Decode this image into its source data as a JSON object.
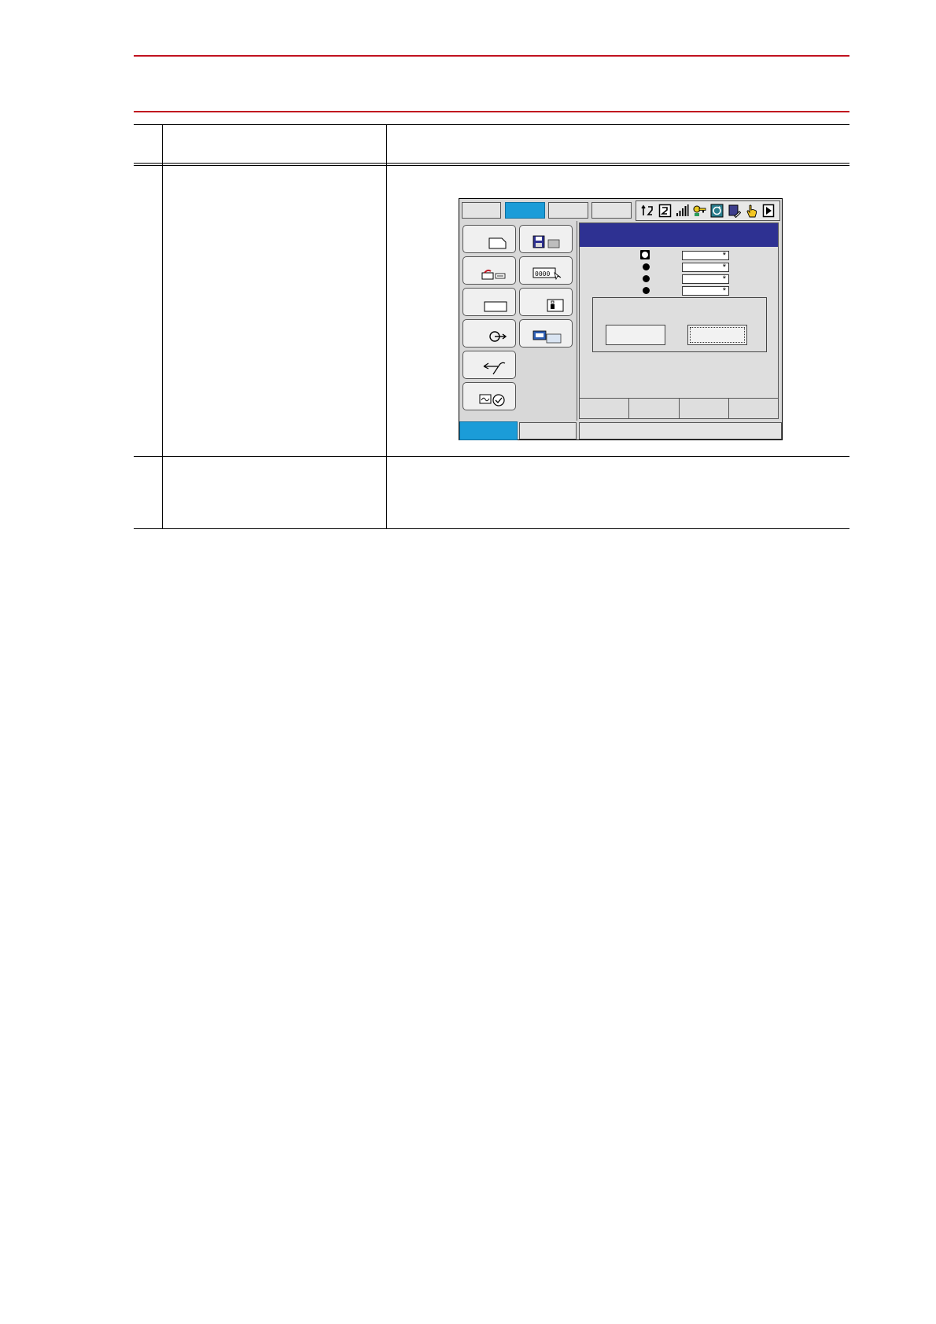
{
  "header": {
    "title": ""
  },
  "table": {
    "headers": [
      "",
      "",
      ""
    ],
    "rows": [
      {
        "step": "",
        "operation": "",
        "explanation": ""
      },
      {
        "step": "",
        "operation": "",
        "explanation": ""
      }
    ]
  },
  "pendant": {
    "tabs": [
      "",
      "",
      "",
      ""
    ],
    "active_tab_index": 1,
    "status_icons": [
      "axis-icon",
      "number-icon",
      "speed-icon",
      "key-icon",
      "cycle-icon",
      "edit-icon",
      "hand-icon",
      "play-icon"
    ],
    "menu_buttons": [
      "document-icon",
      "floppy-icon",
      "robot-icon",
      "variable-icon",
      "blank-icon",
      "lock-icon",
      "arrow-circle-icon",
      "display-icon",
      "wrench-icon",
      "monitor-clock-icon"
    ],
    "parameter_rows": [
      {
        "value": "*"
      },
      {
        "value": "*"
      },
      {
        "value": "*"
      },
      {
        "value": "*"
      }
    ],
    "dialog_buttons": [
      "",
      ""
    ],
    "function_keys": [
      "",
      "",
      "",
      ""
    ],
    "bottom": {
      "main_menu": "",
      "simple_menu": "",
      "message": ""
    },
    "colors": {
      "active_tab": "#1b9cd8",
      "title_bar": "#2e3192",
      "header_rule": "#c1121f"
    }
  }
}
